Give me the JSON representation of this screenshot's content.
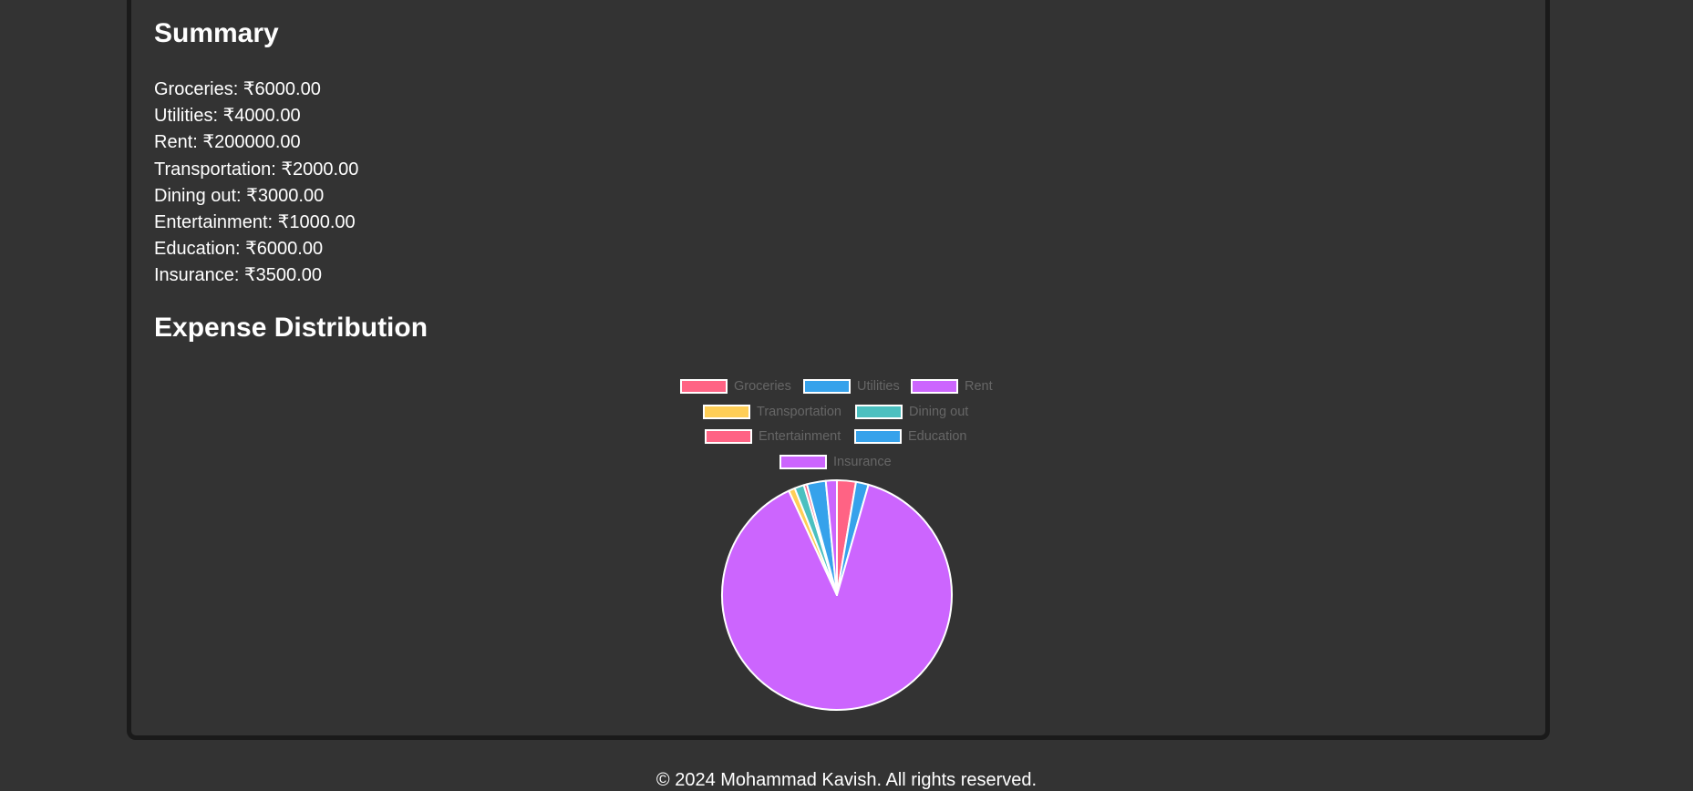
{
  "summary": {
    "title": "Summary",
    "items": [
      "Groceries: ₹6000.00",
      "Utilities: ₹4000.00",
      "Rent: ₹200000.00",
      "Transportation: ₹2000.00",
      "Dining out: ₹3000.00",
      "Entertainment: ₹1000.00",
      "Education: ₹6000.00",
      "Insurance: ₹3500.00"
    ]
  },
  "distribution": {
    "title": "Expense Distribution"
  },
  "chart_data": {
    "type": "pie",
    "categories": [
      "Groceries",
      "Utilities",
      "Rent",
      "Transportation",
      "Dining out",
      "Entertainment",
      "Education",
      "Insurance"
    ],
    "values": [
      6000,
      4000,
      200000,
      2000,
      3000,
      1000,
      6000,
      3500
    ],
    "colors": [
      "#ff6384",
      "#36a2eb",
      "#cc65fe",
      "#ffce56",
      "#4bc0c0",
      "#ff6384",
      "#36a2eb",
      "#cc65fe"
    ],
    "legend_position": "top",
    "border_color": "#ffffff"
  },
  "footer": {
    "text": "© 2024 Mohammad Kavish. All rights reserved."
  }
}
